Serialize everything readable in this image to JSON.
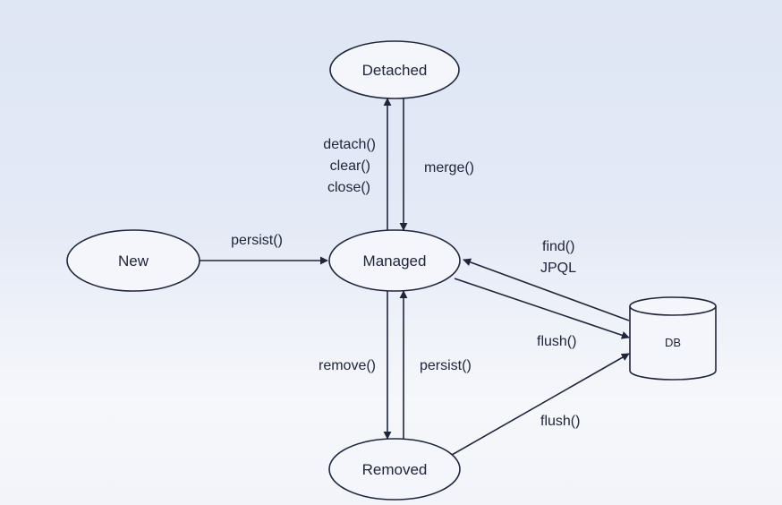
{
  "nodes": {
    "detached": "Detached",
    "new": "New",
    "managed": "Managed",
    "removed": "Removed",
    "db": "DB"
  },
  "edges": {
    "new_to_managed": "persist()",
    "managed_to_detached": [
      "detach()",
      "clear()",
      "close()"
    ],
    "detached_to_managed": "merge()",
    "db_to_managed": [
      "find()",
      "JPQL"
    ],
    "managed_to_db": "flush()",
    "managed_to_removed": "remove()",
    "removed_to_managed": "persist()",
    "removed_to_db": "flush()"
  },
  "colors": {
    "stroke": "#20263a",
    "node_fill": "#f4f6fc"
  }
}
